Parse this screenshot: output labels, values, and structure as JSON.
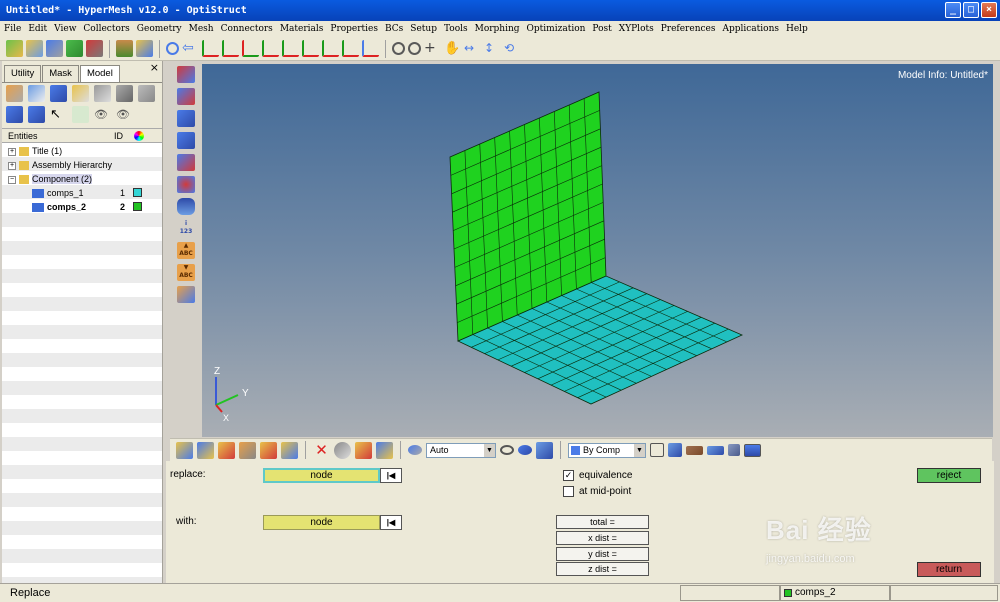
{
  "window": {
    "title": "Untitled* - HyperMesh v12.0 - OptiStruct",
    "buttons": {
      "minimize": "_",
      "maximize": "□",
      "close": "×"
    }
  },
  "menu": [
    "File",
    "Edit",
    "View",
    "Collectors",
    "Geometry",
    "Mesh",
    "Connectors",
    "Materials",
    "Properties",
    "BCs",
    "Setup",
    "Tools",
    "Morphing",
    "Optimization",
    "Post",
    "XYPlots",
    "Preferences",
    "Applications",
    "Help"
  ],
  "browser": {
    "tabs": [
      "Utility",
      "Mask",
      "Model"
    ],
    "active_tab": "Model",
    "close_glyph": "×",
    "headers": {
      "entities": "Entities",
      "id": "ID"
    },
    "tree": [
      {
        "label": "Title (1)",
        "level": 0,
        "expander": "+"
      },
      {
        "label": "Assembly Hierarchy",
        "level": 0,
        "expander": "+"
      },
      {
        "label": "Component (2)",
        "level": 0,
        "expander": "−"
      },
      {
        "label": "comps_1",
        "id": "1",
        "color": "#33d6d6",
        "level": 1
      },
      {
        "label": "comps_2",
        "id": "2",
        "color": "#22c322",
        "level": 1,
        "bold": true
      }
    ]
  },
  "viewport": {
    "model_info": "Model Info: Untitled*",
    "axes": {
      "x": "X",
      "y": "Y",
      "z": "Z"
    },
    "colors": {
      "wall": "#1fd21f",
      "floor": "#20c0c0",
      "mesh_line": "#0a2a0a",
      "bg_top": "#3f6897",
      "bg_bottom": "#a9aeb4"
    },
    "mesh": {
      "wall_divisions": 10,
      "floor_divisions": 10
    }
  },
  "bottom_toolbar": {
    "auto_select": "Auto",
    "by_comp_select": "By Comp"
  },
  "panel": {
    "replace_label": "replace:",
    "replace_value": "node",
    "with_label": "with:",
    "with_value": "node",
    "reset_glyph": "|◀",
    "equivalence_label": "equivalence",
    "equivalence_checked": "✓",
    "midpoint_label": "at mid-point",
    "total_label": "total =",
    "xdist_label": "x dist =",
    "ydist_label": "y dist =",
    "zdist_label": "z dist =",
    "reject_label": "reject",
    "return_label": "return"
  },
  "status": {
    "message": "Replace",
    "current_component": "comps_2"
  },
  "watermark": {
    "main": "Bai 经验",
    "sub": "jingyan.baidu.com"
  }
}
